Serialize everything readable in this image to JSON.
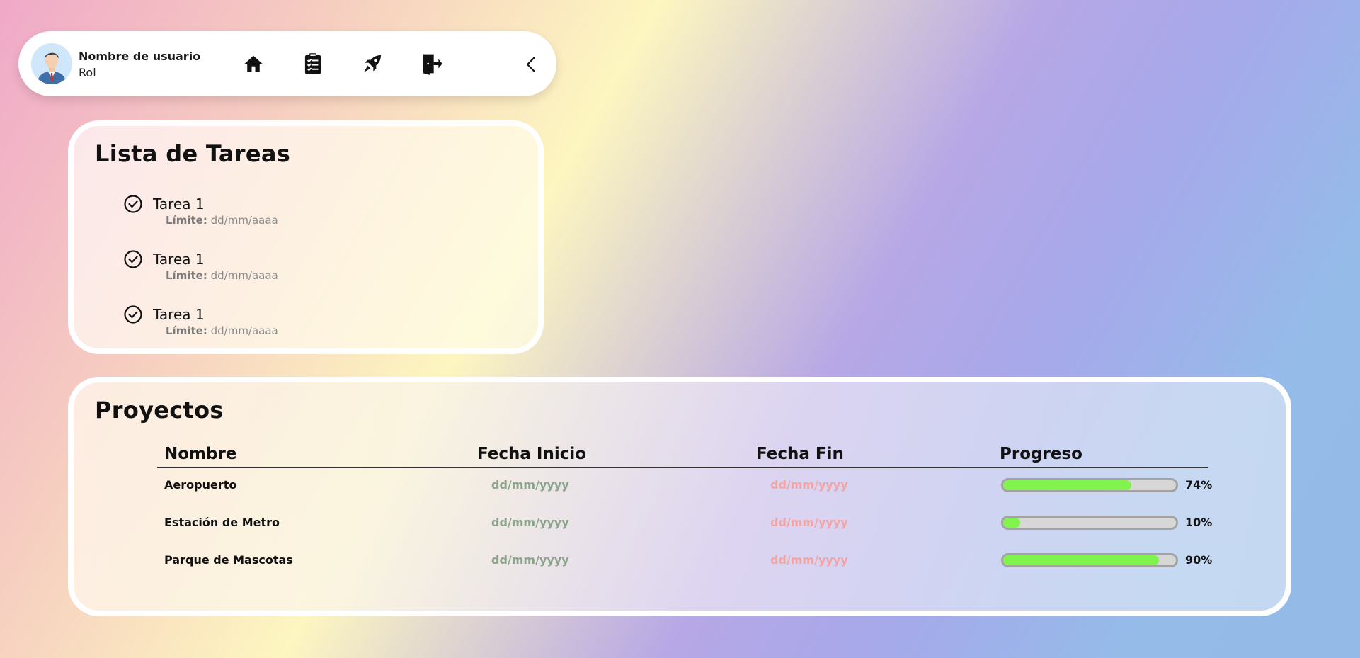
{
  "header": {
    "user_name": "Nombre de usuario",
    "user_role": "Rol",
    "nav": [
      {
        "icon": "home-icon"
      },
      {
        "icon": "clipboard-icon"
      },
      {
        "icon": "rocket-icon"
      },
      {
        "icon": "logout-icon"
      }
    ],
    "collapse_icon": "chevron-left-icon"
  },
  "tasks": {
    "title": "Lista de Tareas",
    "deadline_label": "Límite:",
    "items": [
      {
        "name": "Tarea 1",
        "deadline": "dd/mm/aaaa"
      },
      {
        "name": "Tarea 1",
        "deadline": "dd/mm/aaaa"
      },
      {
        "name": "Tarea 1",
        "deadline": "dd/mm/aaaa"
      }
    ]
  },
  "projects": {
    "title": "Proyectos",
    "columns": [
      "Nombre",
      "Fecha Inicio",
      "Fecha Fin",
      "Progreso"
    ],
    "rows": [
      {
        "name": "Aeropuerto",
        "start": "dd/mm/yyyy",
        "end": "dd/mm/yyyy",
        "progress": 74,
        "progress_label": "74%"
      },
      {
        "name": "Estación de Metro",
        "start": "dd/mm/yyyy",
        "end": "dd/mm/yyyy",
        "progress": 10,
        "progress_label": "10%"
      },
      {
        "name": "Parque de Mascotas",
        "start": "dd/mm/yyyy",
        "end": "dd/mm/yyyy",
        "progress": 90,
        "progress_label": "90%"
      }
    ]
  },
  "colors": {
    "progress_fill": "#80f44d",
    "start_date": "#8aa48b",
    "end_date": "#f2a4a4"
  }
}
